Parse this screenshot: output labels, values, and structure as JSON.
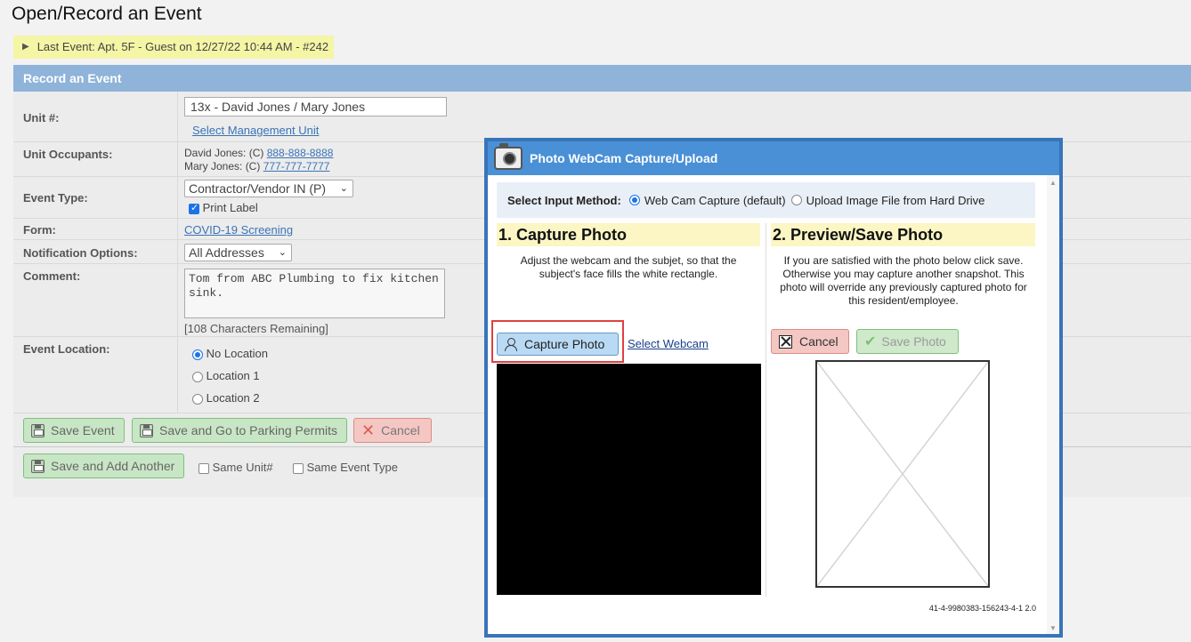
{
  "page": {
    "title": "Open/Record an Event",
    "last_event": "Last Event: Apt. 5F - Guest on 12/27/22 10:44 AM - #242"
  },
  "form": {
    "header": "Record an Event",
    "unit": {
      "label": "Unit #:",
      "value": "13x - David Jones / Mary Jones",
      "select_link": "Select Management Unit"
    },
    "occupants": {
      "label": "Unit Occupants:",
      "list": [
        {
          "prefix": "David Jones: (C) ",
          "phone": "888-888-8888"
        },
        {
          "prefix": "Mary Jones: (C) ",
          "phone": "777-777-7777"
        }
      ]
    },
    "event_type": {
      "label": "Event Type:",
      "value": "Contractor/Vendor IN (P)",
      "print_label": "Print Label",
      "print_checked": true
    },
    "form_field": {
      "label": "Form:",
      "link": "COVID-19 Screening"
    },
    "notification": {
      "label": "Notification Options:",
      "value": "All Addresses"
    },
    "comment": {
      "label": "Comment:",
      "value": "Tom from ABC Plumbing to fix kitchen sink.",
      "remaining": "[108 Characters Remaining]"
    },
    "location": {
      "label": "Event Location:",
      "options": [
        "No Location",
        "Location 1",
        "Location 2"
      ],
      "selected": "No Location"
    },
    "buttons": {
      "save_event": "Save Event",
      "save_parking": "Save and Go to Parking Permits",
      "cancel": "Cancel",
      "save_add": "Save and Add Another"
    },
    "same_unit": "Same Unit#",
    "same_event_type": "Same Event Type"
  },
  "modal": {
    "title": "Photo WebCam Capture/Upload",
    "method_label": "Select Input Method:",
    "method_options": [
      "Web Cam Capture (default)",
      "Upload Image File from Hard Drive"
    ],
    "method_selected": "Web Cam Capture (default)",
    "capture": {
      "heading": "1. Capture Photo",
      "instructions": "Adjust the webcam and the subjet, so that the subject's face fills the white rectangle.",
      "button": "Capture Photo",
      "select_webcam": "Select Webcam"
    },
    "preview": {
      "heading": "2. Preview/Save Photo",
      "instructions": "If you are satisfied with the photo below click save. Otherwise you may capture another snapshot. This photo will override any previously captured photo for this resident/employee.",
      "cancel": "Cancel",
      "save": "Save Photo"
    },
    "version": "41-4-9980383-156243-4-1 2.0"
  },
  "colors": {
    "panel_header": "#8fb3d9",
    "modal_border": "#3874ba",
    "modal_title": "#4a90d6",
    "highlight": "#e04040",
    "last_event_bg": "#f5f5a6"
  }
}
